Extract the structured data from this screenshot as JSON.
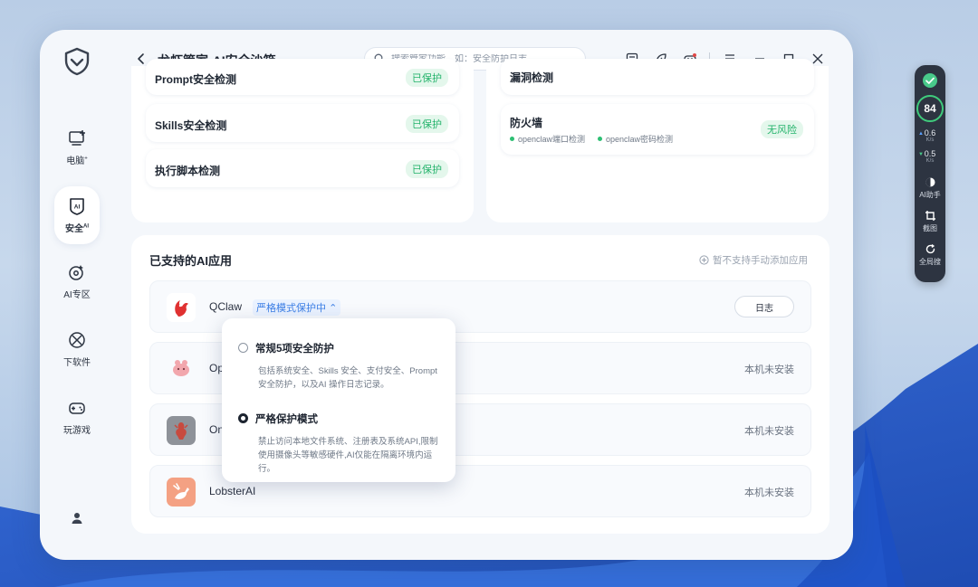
{
  "colors": {
    "accent_blue": "#3c7fe6",
    "safe_green": "#24b36b",
    "safe_green_bg": "#e4f7ec",
    "widget_bg": "#2d3441"
  },
  "window": {
    "title": "龙虾管家-AI安全沙箱",
    "search_placeholder": "搜索管家功能，如：安全防护日志..."
  },
  "sidebar": {
    "items": [
      {
        "label": "电脑",
        "sup": "+",
        "icon": "computer-add-icon"
      },
      {
        "label": "安全",
        "sup": "AI",
        "icon": "ai-shield-icon",
        "active": true
      },
      {
        "label": "AI专区",
        "sup": "",
        "icon": "ai-zone-icon"
      },
      {
        "label": "下软件",
        "sup": "",
        "icon": "download-software-icon"
      },
      {
        "label": "玩游戏",
        "sup": "",
        "icon": "gamepad-icon"
      }
    ]
  },
  "top_left_checks": [
    {
      "label": "Prompt安全检测",
      "status": "已保护"
    },
    {
      "label": "Skills安全检测",
      "status": "已保护"
    },
    {
      "label": "执行脚本检测",
      "status": "已保护"
    }
  ],
  "top_right_checks": {
    "vuln": {
      "label": "漏洞检测"
    },
    "firewall": {
      "label": "防火墙",
      "status": "无风险",
      "sub": [
        "openclaw端口检测",
        "openclaw密码检测"
      ]
    }
  },
  "apps_section": {
    "title": "已支持的AI应用",
    "hint": "暂不支持手动添加应用",
    "apps": [
      {
        "name": "QClaw",
        "mode": "严格模式保护中",
        "action": "日志"
      },
      {
        "name": "OpenClaw",
        "status": "本机未安装"
      },
      {
        "name": "OneClaw",
        "status": "本机未安装"
      },
      {
        "name": "LobsterAI",
        "status": "本机未安装"
      }
    ]
  },
  "mode_popup": {
    "options": [
      {
        "title": "常规5项安全防护",
        "desc": "包括系统安全、Skills 安全、支付安全、Prompt 安全防护，以及AI 操作日志记录。",
        "selected": false
      },
      {
        "title": "严格保护模式",
        "desc": "禁止访问本地文件系统、注册表及系统API,限制使用摄像头等敏感硬件,AI仅能在隔离环境内运行。",
        "selected": true
      }
    ]
  },
  "widget": {
    "score": "84",
    "upload": {
      "value": "0.6",
      "unit": "K/s"
    },
    "download": {
      "value": "0.5",
      "unit": "K/s"
    },
    "tools": [
      {
        "label": "AI助手",
        "icon": "ai-assistant-icon"
      },
      {
        "label": "截图",
        "icon": "screenshot-crop-icon"
      },
      {
        "label": "全局搜",
        "icon": "global-search-icon"
      }
    ]
  }
}
